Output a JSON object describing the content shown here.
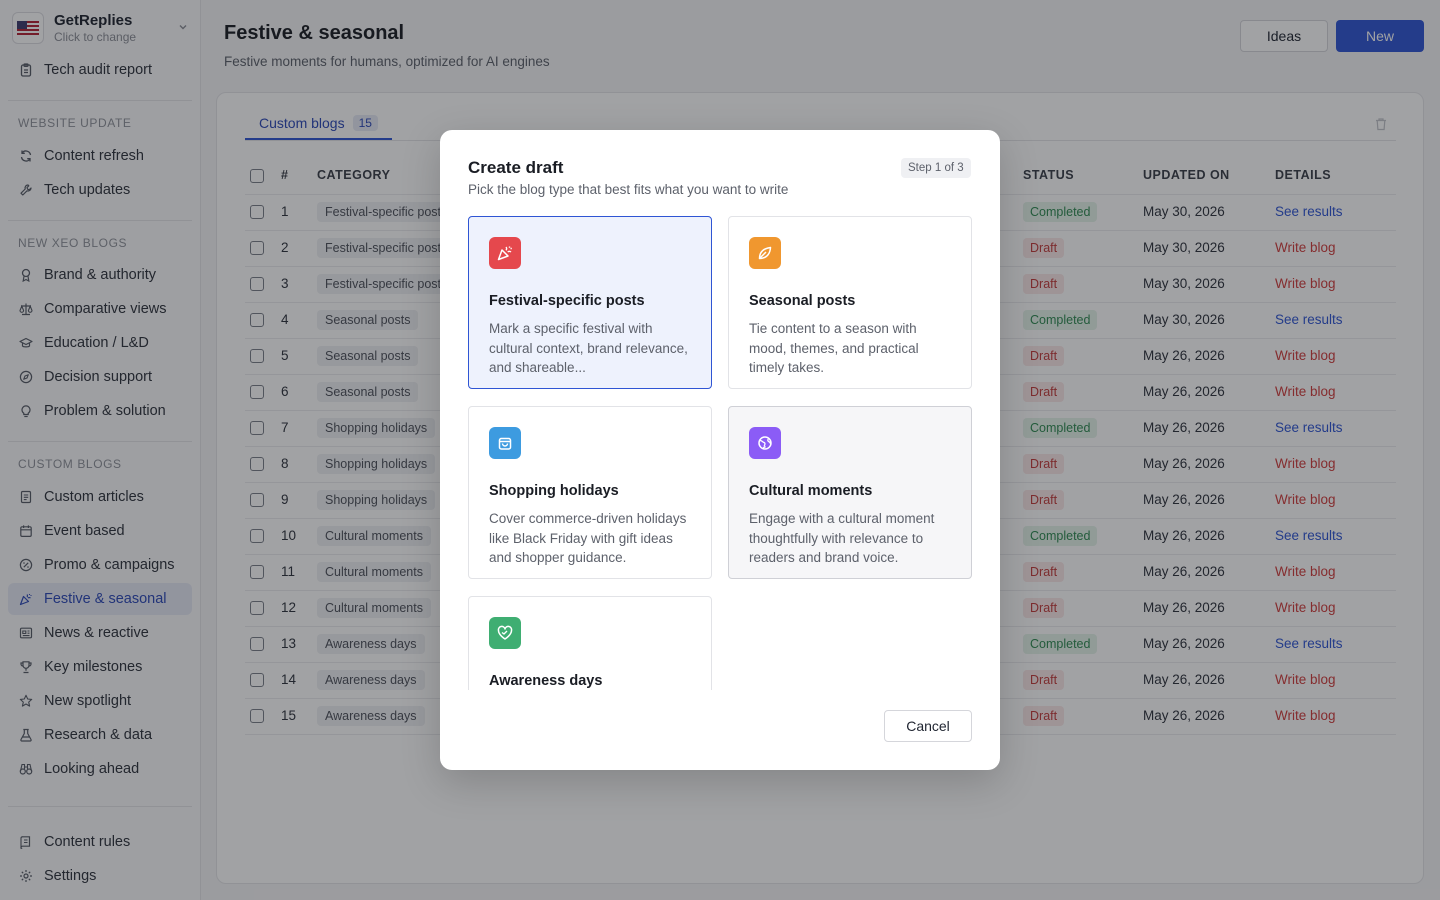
{
  "workspace": {
    "name": "GetReplies",
    "subtitle": "Click to change",
    "flag": "us-flag-icon"
  },
  "sidebar": {
    "top_items": [
      {
        "label": "Tech audit report",
        "icon": "clipboard-icon"
      }
    ],
    "sections": [
      {
        "title": "WEBSITE UPDATE",
        "items": [
          {
            "label": "Content refresh",
            "icon": "refresh-icon"
          },
          {
            "label": "Tech updates",
            "icon": "wrench-icon"
          }
        ]
      },
      {
        "title": "NEW XEO BLOGS",
        "items": [
          {
            "label": "Brand & authority",
            "icon": "award-icon"
          },
          {
            "label": "Comparative views",
            "icon": "scale-icon"
          },
          {
            "label": "Education / L&D",
            "icon": "graduation-cap-icon"
          },
          {
            "label": "Decision support",
            "icon": "compass-icon"
          },
          {
            "label": "Problem & solution",
            "icon": "lightbulb-icon"
          }
        ]
      },
      {
        "title": "CUSTOM BLOGS",
        "items": [
          {
            "label": "Custom articles",
            "icon": "document-icon"
          },
          {
            "label": "Event based",
            "icon": "calendar-icon"
          },
          {
            "label": "Promo & campaigns",
            "icon": "percent-icon"
          },
          {
            "label": "Festive & seasonal",
            "icon": "party-popper-icon",
            "active": true
          },
          {
            "label": "News & reactive",
            "icon": "newspaper-icon"
          },
          {
            "label": "Key milestones",
            "icon": "trophy-icon"
          },
          {
            "label": "New spotlight",
            "icon": "star-icon"
          },
          {
            "label": "Research & data",
            "icon": "flask-icon"
          },
          {
            "label": "Looking ahead",
            "icon": "binoculars-icon"
          }
        ]
      }
    ],
    "bottom_items": [
      {
        "label": "Content rules",
        "icon": "rules-icon"
      },
      {
        "label": "Settings",
        "icon": "gear-icon"
      }
    ]
  },
  "header": {
    "title": "Festive & seasonal",
    "subtitle": "Festive moments for humans, optimized for AI engines",
    "ideas_label": "Ideas",
    "new_label": "New"
  },
  "tabs": [
    {
      "label": "Custom blogs",
      "count": "15"
    }
  ],
  "table": {
    "columns": {
      "num": "#",
      "category": "CATEGORY",
      "status": "STATUS",
      "updated": "UPDATED ON",
      "details": "DETAILS"
    },
    "rows": [
      {
        "num": "1",
        "category": "Festival-specific posts",
        "status": "Completed",
        "updated": "May 30, 2026",
        "details": "See results"
      },
      {
        "num": "2",
        "category": "Festival-specific posts",
        "status": "Draft",
        "updated": "May 30, 2026",
        "details": "Write blog"
      },
      {
        "num": "3",
        "category": "Festival-specific posts",
        "status": "Draft",
        "updated": "May 30, 2026",
        "details": "Write blog"
      },
      {
        "num": "4",
        "category": "Seasonal posts",
        "status": "Completed",
        "updated": "May 30, 2026",
        "details": "See results"
      },
      {
        "num": "5",
        "category": "Seasonal posts",
        "status": "Draft",
        "updated": "May 26, 2026",
        "details": "Write blog"
      },
      {
        "num": "6",
        "category": "Seasonal posts",
        "status": "Draft",
        "updated": "May 26, 2026",
        "details": "Write blog"
      },
      {
        "num": "7",
        "category": "Shopping holidays",
        "status": "Completed",
        "updated": "May 26, 2026",
        "details": "See results"
      },
      {
        "num": "8",
        "category": "Shopping holidays",
        "status": "Draft",
        "updated": "May 26, 2026",
        "details": "Write blog"
      },
      {
        "num": "9",
        "category": "Shopping holidays",
        "status": "Draft",
        "updated": "May 26, 2026",
        "details": "Write blog"
      },
      {
        "num": "10",
        "category": "Cultural moments",
        "status": "Completed",
        "updated": "May 26, 2026",
        "details": "See results"
      },
      {
        "num": "11",
        "category": "Cultural moments",
        "status": "Draft",
        "updated": "May 26, 2026",
        "details": "Write blog"
      },
      {
        "num": "12",
        "category": "Cultural moments",
        "status": "Draft",
        "updated": "May 26, 2026",
        "details": "Write blog"
      },
      {
        "num": "13",
        "category": "Awareness days",
        "status": "Completed",
        "updated": "May 26, 2026",
        "details": "See results"
      },
      {
        "num": "14",
        "category": "Awareness days",
        "status": "Draft",
        "updated": "May 26, 2026",
        "details": "Write blog"
      },
      {
        "num": "15",
        "category": "Awareness days",
        "status": "Draft",
        "updated": "May 26, 2026",
        "details": "Write blog"
      }
    ]
  },
  "modal": {
    "title": "Create draft",
    "subtitle": "Pick the blog type that best fits what you want to write",
    "step": "Step 1 of 3",
    "cancel_label": "Cancel",
    "options": [
      {
        "title": "Festival-specific posts",
        "description": "Mark a specific festival with cultural context, brand relevance, and shareable...",
        "icon": "party-popper-icon",
        "color": "#e5484d",
        "state": "selected"
      },
      {
        "title": "Seasonal posts",
        "description": "Tie content to a season with mood, themes, and practical timely takes.",
        "icon": "leaf-icon",
        "color": "#f0972f",
        "state": "default"
      },
      {
        "title": "Shopping holidays",
        "description": "Cover commerce-driven holidays like Black Friday with gift ideas and shopper guidance.",
        "icon": "shopping-bag-icon",
        "color": "#3d9be0",
        "state": "default"
      },
      {
        "title": "Cultural moments",
        "description": "Engage with a cultural moment thoughtfully with relevance to readers and brand voice.",
        "icon": "globe-icon",
        "color": "#8b5cf6",
        "state": "hover"
      },
      {
        "title": "Awareness days",
        "description": "",
        "icon": "heart-handshake-icon",
        "color": "#3fae72",
        "state": "default"
      }
    ]
  }
}
